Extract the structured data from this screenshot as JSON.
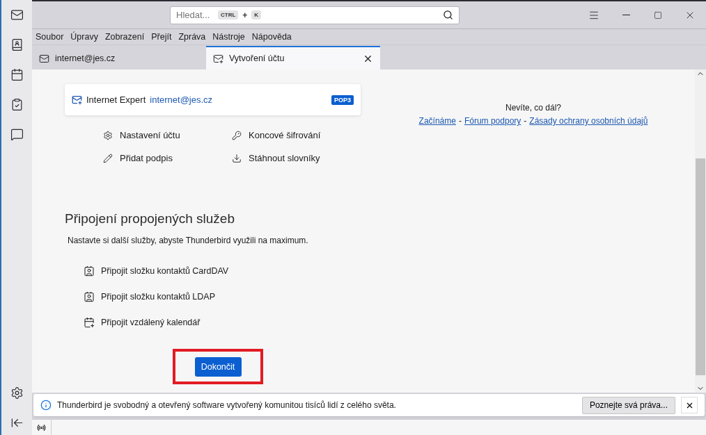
{
  "search": {
    "placeholder": "Hledat...",
    "shortcut_keys": [
      "CTRL",
      "+",
      "K"
    ]
  },
  "menu": [
    "Soubor",
    "Úpravy",
    "Zobrazení",
    "Přejít",
    "Zpráva",
    "Nástroje",
    "Nápověda"
  ],
  "tabs": [
    {
      "label": "internet@jes.cz",
      "kind": "mail",
      "selected": false
    },
    {
      "label": "Vytvoření účtu",
      "kind": "new-account",
      "selected": true
    }
  ],
  "account": {
    "name": "Internet Expert",
    "email": "internet@jes.cz",
    "badge": "POP3"
  },
  "actions": [
    {
      "label": "Nastavení účtu",
      "kind": "settings"
    },
    {
      "label": "Koncové šifrování",
      "kind": "key"
    },
    {
      "label": "Přidat podpis",
      "kind": "signature"
    },
    {
      "label": "Stáhnout slovníky",
      "kind": "download"
    }
  ],
  "help": {
    "title": "Nevíte, co dál?",
    "links": [
      "Začínáme",
      "Fórum podpory",
      "Zásady ochrany osobních údajů"
    ],
    "separator": "-"
  },
  "services": {
    "heading": "Připojení propojených služeb",
    "subtitle": "Nastavte si další služby, abyste Thunderbird využili na maximum.",
    "items": [
      {
        "label": "Připojit složku kontaktů CardDAV",
        "kind": "addressbook"
      },
      {
        "label": "Připojit složku kontaktů LDAP",
        "kind": "addressbook"
      },
      {
        "label": "Připojit vzdálený kalendář",
        "kind": "calendar"
      }
    ]
  },
  "finish_button": {
    "label": "Dokončit",
    "highlighted": true
  },
  "notification": {
    "text": "Thunderbird je svobodný a otevřený software vytvořený komunitou tisíců lidí z celého světa.",
    "button": "Poznejte svá práva..."
  }
}
